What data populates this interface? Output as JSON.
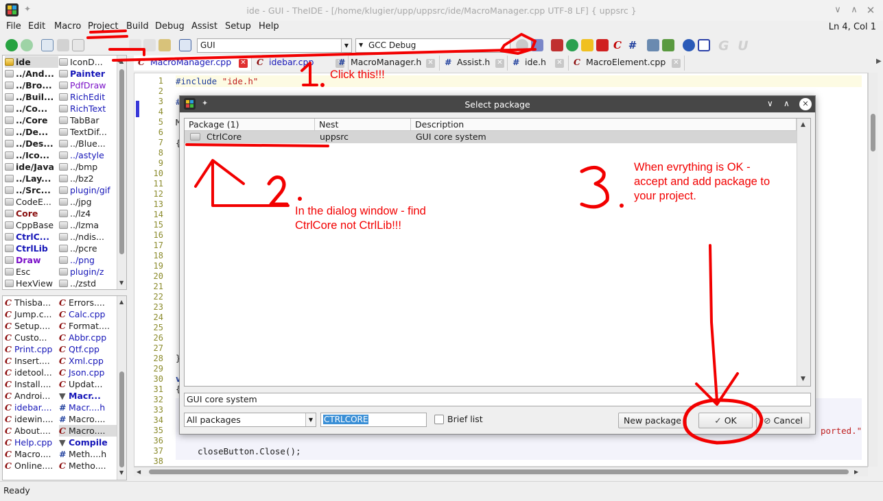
{
  "window": {
    "title": "ide - GUI - TheIDE - [/home/klugier/upp/uppsrc/ide/MacroManager.cpp UTF-8 LF] { uppsrc }"
  },
  "menubar": {
    "items": [
      "File",
      "Edit",
      "Macro",
      "Project",
      "Build",
      "Debug",
      "Assist",
      "Setup",
      "Help"
    ],
    "position": "Ln 4, Col 1"
  },
  "toolbar": {
    "main_package": "GUI",
    "build_method": "GCC Debug",
    "brand": "G U"
  },
  "packages_col1": [
    "ide",
    "../And...",
    "../Bro...",
    "../Buil...",
    "../Co...",
    "../Core",
    "../De...",
    "../Des...",
    "../Ico...",
    "ide/Java",
    "../Lay...",
    "../Src...",
    "CodeE...",
    "Core",
    "CppBase",
    "CtrlC...",
    "CtrlLib",
    "Draw",
    "Esc",
    "HexView"
  ],
  "packages_col2": [
    "IconD...",
    "Painter",
    "PdfDraw",
    "RichEdit",
    "RichText",
    "TabBar",
    "TextDif...",
    "../Blue...",
    "../astyle",
    "../bmp",
    "../bz2",
    "plugin/gif",
    "../jpg",
    "../lz4",
    "../lzma",
    "../ndis...",
    "../pcre",
    "../png",
    "plugin/z",
    "../zstd"
  ],
  "files_col1": [
    "Thisba...",
    "Jump.c...",
    "Setup....",
    "Custo...",
    "Print.cpp",
    "Insert....",
    "idetool...",
    "Install....",
    "Androi...",
    "idebar....",
    "idewin....",
    "About....",
    "Help.cpp",
    "Macro....",
    "Online...."
  ],
  "files_col2": [
    "Errors....",
    "Calc.cpp",
    "Format....",
    "Abbr.cpp",
    "Qtf.cpp",
    "Xml.cpp",
    "Json.cpp",
    "Updat...",
    "Macr...",
    "Macr....h",
    "Macro....",
    "Macro....",
    "Compile",
    "Meth....h",
    "Metho...."
  ],
  "tabs": [
    {
      "label": "MacroManager.cpp"
    },
    {
      "label": "idebar.cpp"
    },
    {
      "label": "MacroManager.h"
    },
    {
      "label": "Assist.h"
    },
    {
      "label": "ide.h"
    },
    {
      "label": "MacroElement.cpp"
    }
  ],
  "editor": {
    "line_numbers": [
      "1",
      "2",
      "3",
      "4",
      "5",
      "6",
      "7",
      "8",
      "9",
      "10",
      "11",
      "12",
      "13",
      "14",
      "15",
      "16",
      "17",
      "18",
      "19",
      "20",
      "21",
      "22",
      "23",
      "24",
      "25",
      "26",
      "27",
      "28",
      "29",
      "30",
      "31",
      "32",
      "33",
      "34",
      "35",
      "36",
      "37",
      "38"
    ],
    "line1_directive": "#include",
    "line1_file": "\"ide.h\"",
    "line3": "#",
    "line5": "M",
    "line6": "{",
    "line28": "}",
    "line30": "v",
    "line31": "{",
    "line35_tail": "ported.\"",
    "line37": "closeButton.Close();"
  },
  "dialog": {
    "title": "Select package",
    "columns": [
      "Package (1)",
      "Nest",
      "Description"
    ],
    "row": {
      "package": "CtrlCore",
      "nest": "uppsrc",
      "description": "GUI core system"
    },
    "description_field": "GUI core system",
    "filter": "All packages",
    "search": "CTRLCORE",
    "brief_list_label": "Brief list",
    "new_package_label": "New package",
    "ok_label": "OK",
    "cancel_label": "Cancel"
  },
  "annotations": {
    "num1": "1.",
    "step1": "Click this!!!",
    "num2": "2.",
    "step2_line1": "In the dialog window - find",
    "step2_line2": "CtrlCore not CtrlLib!!!",
    "num3": "3.",
    "step3_line1": "When evrything is OK -",
    "step3_line2": "accept and add package to",
    "step3_line3": "your project."
  },
  "status": {
    "text": "Ready"
  },
  "colors": {
    "annotation": "#f20000",
    "dialog_title": "#474747",
    "selection": "#3a8fd6"
  }
}
